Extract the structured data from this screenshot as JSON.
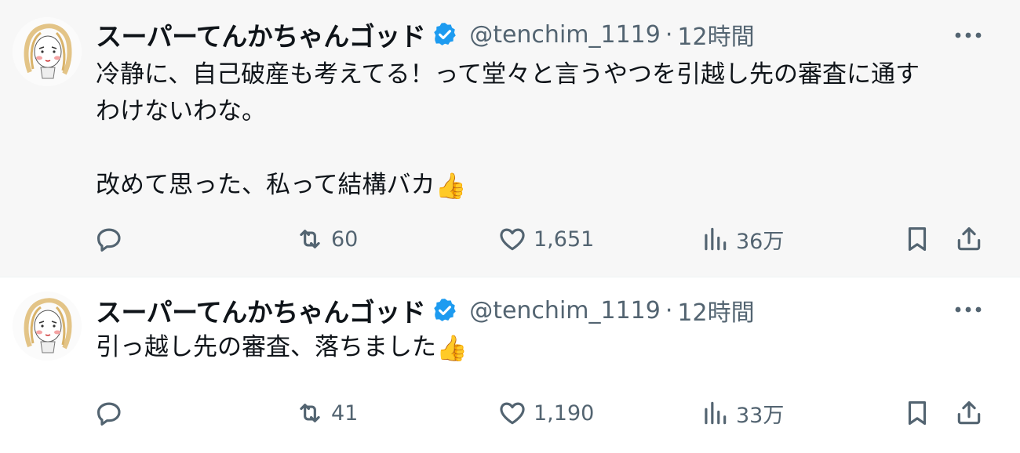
{
  "tweets": [
    {
      "author": {
        "name": "スーパーてんかちゃんゴッド",
        "handle": "@tenchim_1119"
      },
      "separator": "·",
      "time": "12時間",
      "text": "冷静に、自己破産も考えてる！って堂々と言うやつを引越し先の審査に通す\nわけないわな。\n\n改めて思った、私って結構バカ",
      "emoji": "👍",
      "stats": {
        "retweets": "60",
        "likes": "1,651",
        "views": "36万"
      }
    },
    {
      "author": {
        "name": "スーパーてんかちゃんゴッド",
        "handle": "@tenchim_1119"
      },
      "separator": "·",
      "time": "12時間",
      "text": "引っ越し先の審査、落ちました",
      "emoji": "👍",
      "stats": {
        "retweets": "41",
        "likes": "1,190",
        "views": "33万"
      }
    }
  ],
  "colors": {
    "verified": "#1d9bf0",
    "muted": "#536471",
    "text": "#0f1419",
    "highlight_bg": "#f7f7f7"
  },
  "icons": {
    "verified": "verified-badge-icon",
    "more": "more-dots-icon",
    "reply": "reply-icon",
    "retweet": "retweet-icon",
    "like": "heart-icon",
    "views": "views-chart-icon",
    "bookmark": "bookmark-icon",
    "share": "share-icon"
  }
}
